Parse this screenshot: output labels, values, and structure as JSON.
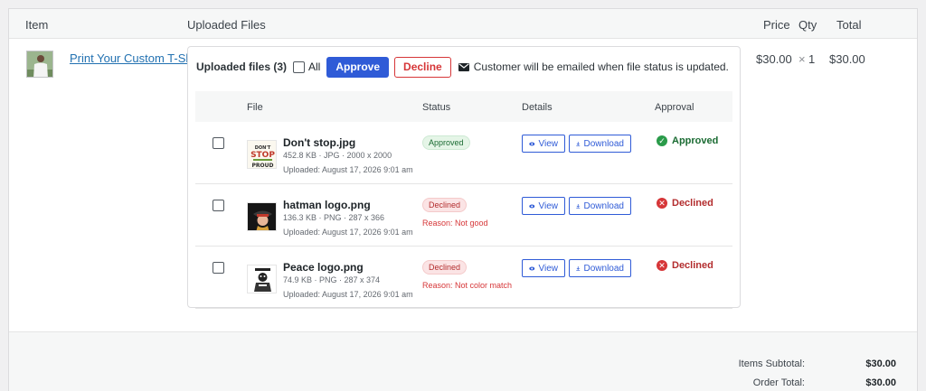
{
  "columns": {
    "item": "Item",
    "uploaded": "Uploaded Files",
    "price": "Price",
    "qty": "Qty",
    "total": "Total"
  },
  "product": {
    "name": "Print Your Custom T-Shirt",
    "price": "$30.00",
    "qty_prefix": "×",
    "qty": "1",
    "total": "$30.00"
  },
  "toolbar": {
    "title": "Uploaded files (3)",
    "all_label": "All",
    "approve_label": "Approve",
    "decline_label": "Decline",
    "note": "Customer will be emailed when file status is updated."
  },
  "file_table": {
    "headers": {
      "file": "File",
      "status": "Status",
      "details": "Details",
      "approval": "Approval"
    },
    "view_label": "View",
    "download_label": "Download",
    "rows": [
      {
        "name": "Don't stop.jpg",
        "meta": "452.8 KB · JPG · 2000 x 2000",
        "date": "Uploaded: August 17, 2026 9:01 am",
        "status": "Approved",
        "reason": "",
        "approval": "Approved"
      },
      {
        "name": "hatman logo.png",
        "meta": "136.3 KB · PNG · 287 x 366",
        "date": "Uploaded: August 17, 2026 9:01 am",
        "status": "Declined",
        "reason": "Reason: Not good",
        "approval": "Declined"
      },
      {
        "name": "Peace logo.png",
        "meta": "74.9 KB · PNG · 287 x 374",
        "date": "Uploaded: August 17, 2026 9:01 am",
        "status": "Declined",
        "reason": "Reason: Not color match",
        "approval": "Declined"
      }
    ]
  },
  "totals": {
    "subtotal_label": "Items Subtotal:",
    "subtotal": "$30.00",
    "order_label": "Order Total:",
    "order": "$30.00"
  },
  "thumb_text": {
    "dont_stop_top": "DON'T",
    "dont_stop_mid": "STOP",
    "dont_stop_bot": "PROUD"
  },
  "colors": {
    "primary": "#2f5bd7",
    "danger": "#d63638",
    "success": "#2a9b4a"
  }
}
